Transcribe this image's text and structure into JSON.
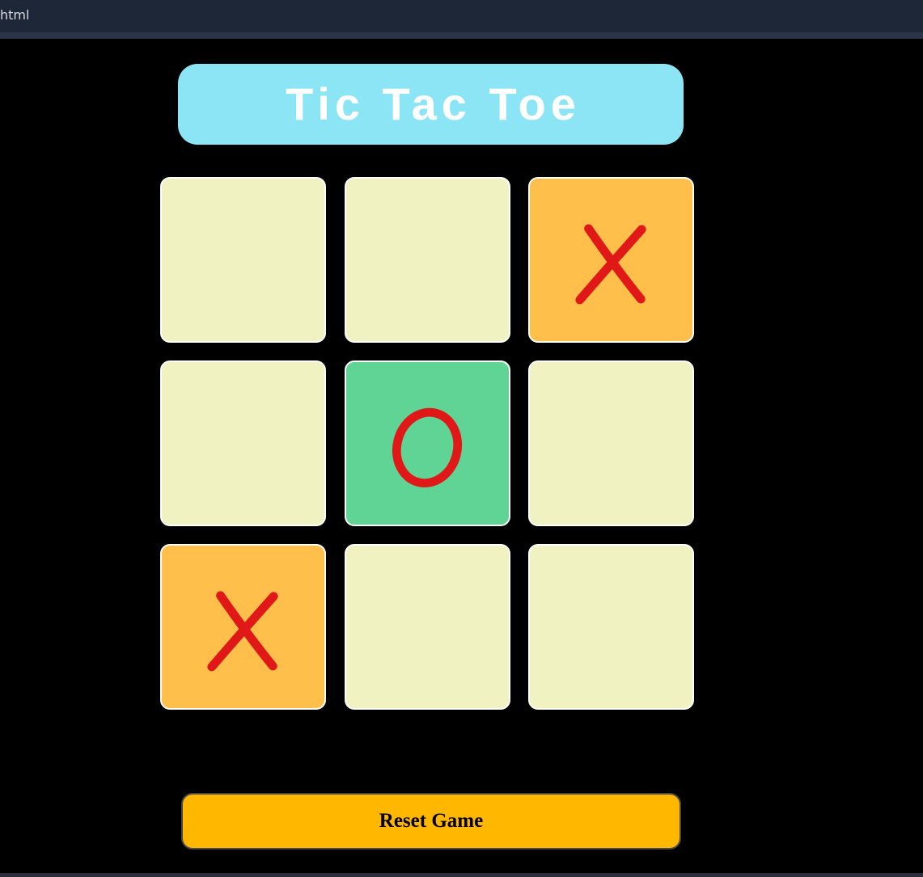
{
  "window": {
    "tab_label": "html"
  },
  "game": {
    "title": "Tic Tac Toe",
    "reset_label": "Reset Game",
    "board": [
      "",
      "",
      "X",
      "",
      "O",
      "",
      "X",
      "",
      ""
    ]
  },
  "colors": {
    "title_bg": "#8ce5f4",
    "cell_empty": "#f0f2c2",
    "cell_x": "#ffbf4a",
    "cell_o": "#5fd495",
    "mark": "#e01818",
    "reset_bg": "#ffb700"
  }
}
